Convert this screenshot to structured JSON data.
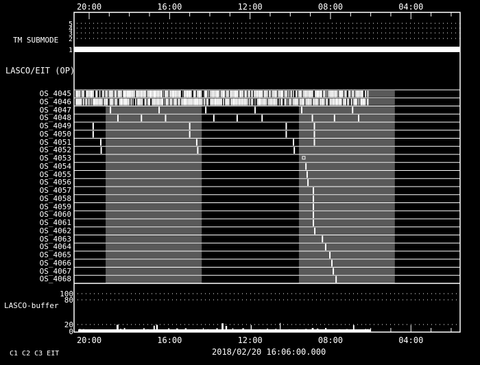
{
  "time_axis": {
    "ticks": [
      "20:00",
      "16:00",
      "12:00",
      "08:00",
      "04:00"
    ],
    "tick_hours_before_first": [
      0,
      4,
      8,
      12,
      16
    ]
  },
  "tm_submode": {
    "label": "TM SUBMODE",
    "levels": [
      "5",
      "4",
      "3",
      "2",
      "1"
    ],
    "active_level": 1
  },
  "lasco_eit_label": "LASCO/EIT (OP)",
  "striped_rows": [
    "OS_4045",
    "OS_4046"
  ],
  "rows": [
    {
      "name": "OS_4045",
      "markers": []
    },
    {
      "name": "OS_4046",
      "markers": []
    },
    {
      "name": "OS_4047",
      "markers": [
        1.06,
        3.48,
        5.8,
        8.25,
        10.57,
        13.1
      ]
    },
    {
      "name": "OS_4048",
      "markers": [
        1.43,
        2.6,
        3.8,
        6.2,
        7.36,
        8.6,
        11.1,
        12.2,
        13.4
      ]
    },
    {
      "name": "OS_4049",
      "markers": [
        0.2,
        5.0,
        9.8,
        11.2
      ]
    },
    {
      "name": "OS_4050",
      "markers": [
        0.2,
        5.0,
        9.8,
        11.2
      ]
    },
    {
      "name": "OS_4051",
      "markers": [
        0.58,
        5.35,
        10.16,
        11.2
      ]
    },
    {
      "name": "OS_4052",
      "markers": [
        0.6,
        5.4,
        10.2
      ]
    },
    {
      "name": "OS_4053",
      "markers": [
        10.67
      ]
    },
    {
      "name": "OS_4054",
      "markers": [
        10.78
      ]
    },
    {
      "name": "OS_4055",
      "markers": [
        10.84
      ]
    },
    {
      "name": "OS_4056",
      "markers": [
        10.88
      ]
    },
    {
      "name": "OS_4057",
      "markers": [
        11.15
      ]
    },
    {
      "name": "OS_4058",
      "markers": [
        11.15
      ]
    },
    {
      "name": "OS_4059",
      "markers": [
        11.15
      ]
    },
    {
      "name": "OS_4060",
      "markers": [
        11.15
      ]
    },
    {
      "name": "OS_4061",
      "markers": [
        11.15
      ]
    },
    {
      "name": "OS_4062",
      "markers": [
        11.22
      ]
    },
    {
      "name": "OS_4063",
      "markers": [
        11.6
      ]
    },
    {
      "name": "OS_4064",
      "markers": [
        11.76
      ]
    },
    {
      "name": "OS_4065",
      "markers": [
        11.97
      ]
    },
    {
      "name": "OS_4066",
      "markers": [
        12.07
      ]
    },
    {
      "name": "OS_4067",
      "markers": [
        12.14
      ]
    },
    {
      "name": "OS_4068",
      "markers": [
        12.28
      ]
    }
  ],
  "gray_spans_hours": [
    [
      0.82,
      5.6
    ],
    [
      10.43,
      15.2
    ]
  ],
  "striped_span_hours": [
    -0.68,
    13.9
  ],
  "buffer": {
    "label": "LASCO-buffer",
    "levels": [
      "100",
      "80",
      "20",
      "0"
    ],
    "data_end_hours": 14.0
  },
  "footer": {
    "instruments": "C1  C2  C3  EIT",
    "timestamp": "2018/02/20 16:06:00.000"
  },
  "colors": {
    "gray_span": "#595959",
    "stripe": "#dcdcdc"
  }
}
